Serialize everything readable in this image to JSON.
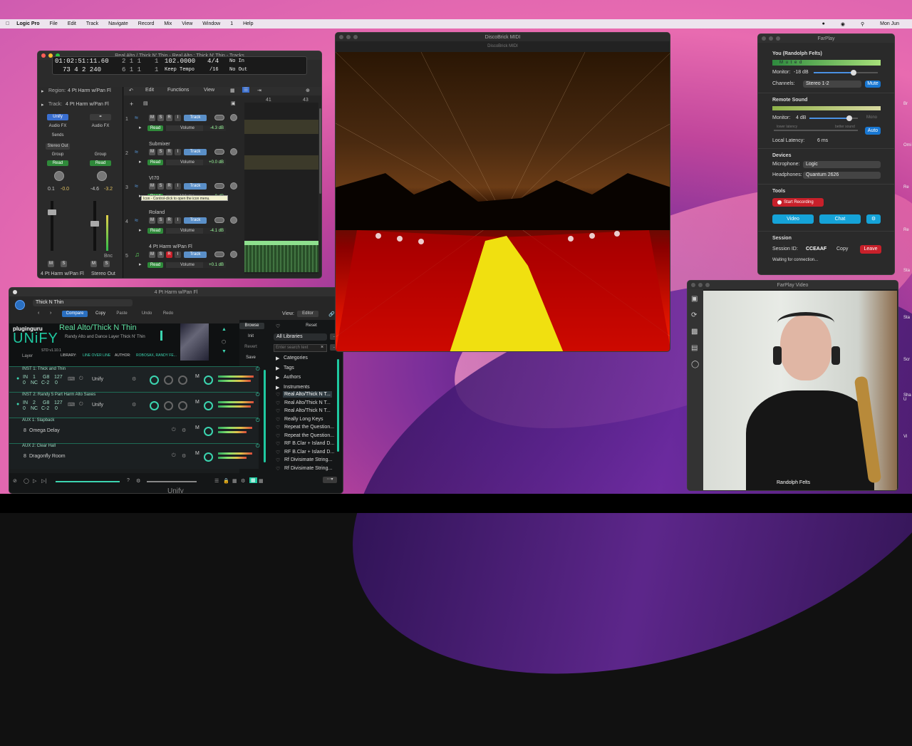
{
  "menubar": {
    "app": "Logic Pro",
    "items": [
      "File",
      "Edit",
      "Track",
      "Navigate",
      "Record",
      "Mix",
      "View",
      "Window",
      "1",
      "Help"
    ],
    "clock": "Mon Jun"
  },
  "logic": {
    "title": "Real Alto / Thick N' Thin - Real Alto : Thick N' Thin - Tracks",
    "lcd": {
      "time": "01:02:51:11.60",
      "bars1": "2  1  1",
      "sub1": "1",
      "bpm": "102.0000",
      "sig": "4/4",
      "in": "No In",
      "pos2": "73  4  2  240",
      "bars2": "6  1  1",
      "sub2": "1",
      "mode": "Keep Tempo",
      "div": "/16",
      "out": "No Out"
    },
    "region_label": "Region:",
    "region_name": "4 Pt Harm w/Pan Fl",
    "track_label": "Track:",
    "track_name": "4 Pt Harm w/Pan Fl",
    "toolbar": {
      "edit": "Edit",
      "functions": "Functions",
      "view": "View"
    },
    "ruler": [
      "41",
      "43"
    ],
    "inspector": {
      "unify": "Unify",
      "audiofx": "Audio FX",
      "sends": "Sends",
      "stereo_out": "Stereo Out",
      "group": "Group",
      "read": "Read",
      "v1a": "0.1",
      "v1b": "-0.0",
      "v2a": "-4.6",
      "v2b": "-3.2",
      "m": "M",
      "s": "S",
      "bnc": "Bnc",
      "name1": "4 Pt Harm w/Pan Fl",
      "name2": "Stereo Out"
    },
    "tracks": [
      {
        "num": "1",
        "name": "",
        "vol": "-4.3 dB"
      },
      {
        "num": "2",
        "name": "Submixer",
        "vol": "+0.0 dB"
      },
      {
        "num": "3",
        "name": "VI70",
        "vol": "0 dB"
      },
      {
        "num": "4",
        "name": "Roland",
        "vol": "-4.1 dB"
      },
      {
        "num": "5",
        "name": "4 Pt Harm w/Pan Fl",
        "vol": "+0.1 dB"
      }
    ],
    "track_labels": {
      "m": "M",
      "s": "S",
      "r": "R",
      "i": "I",
      "track": "Track",
      "read": "Read",
      "volume": "Volume"
    },
    "tooltip": "Icon - Control-click to open the icon menu."
  },
  "unify": {
    "title": "4 Pt Harm w/Pan Fl",
    "preset": "Thick N Thin",
    "buttons": {
      "compare": "Compare",
      "copy": "Copy",
      "paste": "Paste",
      "undo": "Undo",
      "redo": "Redo",
      "view": "View:",
      "editor": "Editor"
    },
    "brand1": "pluginguru",
    "brand2": "UNiFY",
    "version": "STD v1.10.1",
    "layer": "Layer",
    "patch": "Real Alto/Thick N Thin",
    "desc": "Randy Alto and Dance Layer Thick N' Thin",
    "library_label": "LIBRARY:",
    "library": "LINE OVER LINE",
    "author_label": "AUTHOR:",
    "author": "ROBOSAX, RANDY FE...",
    "side": {
      "browse": "Browse",
      "reset": "Reset",
      "init": "Init",
      "revert": "Revert",
      "save": "Save"
    },
    "lib_select": "All Libraries",
    "search_ph": "Enter search text",
    "tree": [
      "Categories",
      "Tags",
      "Authors",
      "Instruments"
    ],
    "results": [
      "Real Alto/Thick N T...",
      "Real Alto/Thick N T...",
      "Real Alto/Thick N T...",
      "Really Long Keys",
      "Repeat the Question...",
      "Repeat the Question...",
      "RF B.Clar + Island D...",
      "RF B.Clar + Island D...",
      "Rf Divisimate String...",
      "Rf Divisimate String..."
    ],
    "insts": [
      {
        "header": "INST 1:  Thick and Thin",
        "ch": "1",
        "in": "IN",
        "nc": "NC",
        "lo": "C-2",
        "hi": "G8",
        "vel1": "127",
        "vel0": "0",
        "plugin": "Unify"
      },
      {
        "header": "INST 2:  Randy 5 Part Harm Alto Saxes",
        "ch": "2",
        "in": "IN",
        "nc": "NC",
        "lo": "C-2",
        "hi": "G8",
        "vel1": "127",
        "vel0": "0",
        "plugin": "Unify"
      }
    ],
    "auxes": [
      {
        "header": "AUX 1:  Slapback",
        "name": "Omega Delay",
        "num": "8"
      },
      {
        "header": "AUX 2:  Clear Hall",
        "name": "Dragonfly Room",
        "num": "8"
      }
    ],
    "footer": "Unify"
  },
  "disco": {
    "title": "DiscoBrick MIDI",
    "subtitle": "DiscoBrick MIDI"
  },
  "farplay": {
    "title": "FarPlay",
    "you": "You (Randolph Felts)",
    "muted": "M u t e d",
    "monitor_label": "Monitor:",
    "monitor_val": "-18 dB",
    "monitor_level": 0.62,
    "channels_label": "Channels:",
    "channels_val": "Stereo 1-2",
    "mute_btn": "Mute",
    "remote": "Remote Sound",
    "remote_monitor": "4 dB",
    "mono": "Mono",
    "remote_level": 0.82,
    "lower": "lower latency",
    "better": "better sound",
    "auto": "Auto",
    "latency_label": "Local Latency:",
    "latency_val": "6 ms",
    "devices": "Devices",
    "mic_label": "Microphone:",
    "mic_val": "Logic",
    "hp_label": "Headphones:",
    "hp_val": "Quantum 2626",
    "tools": "Tools",
    "record": "Start Recording",
    "video": "Video",
    "chat": "Chat",
    "session": "Session",
    "sid_label": "Session ID:",
    "sid": "CCEAAF",
    "copy": "Copy",
    "leave": "Leave",
    "waiting": "Waiting for connection..."
  },
  "video": {
    "title": "FarPlay Video",
    "name": "Randolph Felts"
  },
  "edge": [
    "Br",
    "Omi",
    "Re",
    "Re",
    "Sta",
    "Sta",
    "Scr",
    "Sha U",
    "Vi"
  ]
}
